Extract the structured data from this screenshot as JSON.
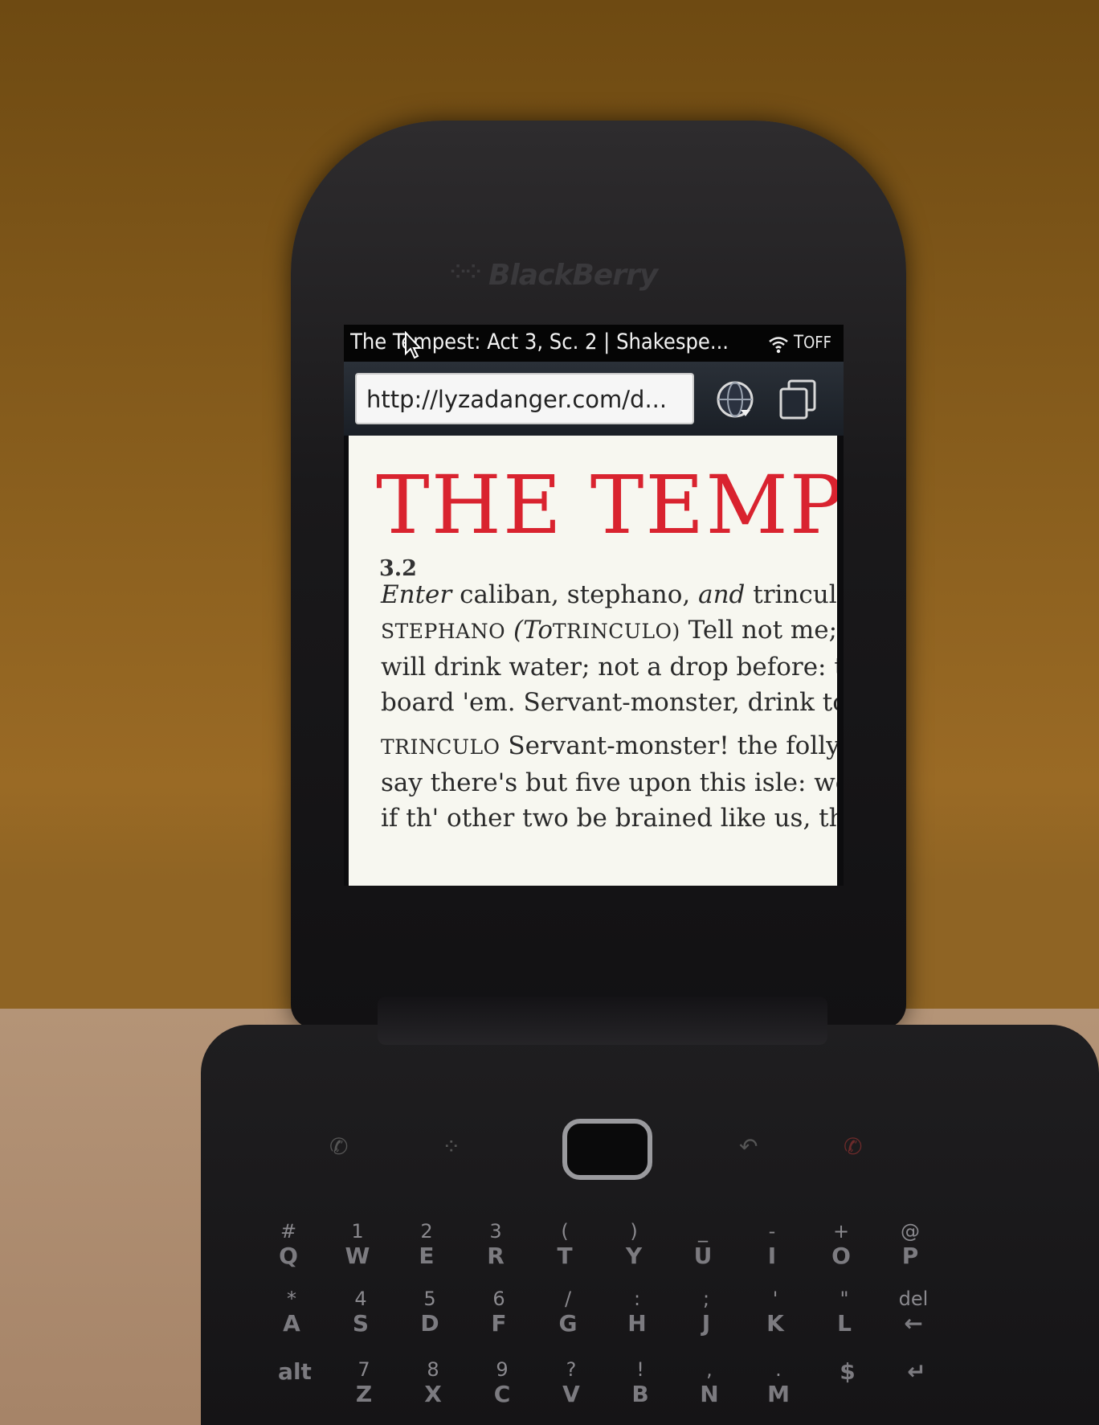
{
  "device": {
    "brand": "BlackBerry"
  },
  "statusbar": {
    "tab_title": "The Tempest: Act 3, Sc. 2 | Shakespe...",
    "radio_status": "OFF",
    "wifi_icon": "wifi-icon",
    "cursor_icon": "pointer-cursor-icon"
  },
  "toolbar": {
    "url": "http://lyzadanger.com/d...",
    "globe_icon": "globe-icon",
    "tabs_icon": "tabs-icon"
  },
  "page": {
    "title": "THE TEMPE",
    "scene": "3.2",
    "stage_direction": {
      "enter": "Enter",
      "chars1": "caliban, stephano,",
      "and": "and",
      "chars2": "trinculo"
    },
    "stephano_line": {
      "speaker": "STEPHANO",
      "aside_to": "(To",
      "aside_name": "TRINCULO)",
      "text1": "Tell not me; w",
      "text2": "will drink water; not a drop before: the",
      "text3": "board 'em. Servant-monster, drink to n"
    },
    "trinculo_line": {
      "speaker": "TRINCULO",
      "text1": "Servant-monster! the folly c",
      "text2": "say there's but five upon this isle: we a",
      "text3": "if th' other two be brained like us, the"
    }
  },
  "keyboard": {
    "row1": [
      {
        "alt": "#",
        "key": "Q"
      },
      {
        "alt": "1",
        "key": "W"
      },
      {
        "alt": "2",
        "key": "E"
      },
      {
        "alt": "3",
        "key": "R"
      },
      {
        "alt": "(",
        "key": "T"
      },
      {
        "alt": ")",
        "key": "Y"
      },
      {
        "alt": "_",
        "key": "U"
      },
      {
        "alt": "-",
        "key": "I"
      },
      {
        "alt": "+",
        "key": "O"
      },
      {
        "alt": "@",
        "key": "P"
      }
    ],
    "row2": [
      {
        "alt": "*",
        "key": "A"
      },
      {
        "alt": "4",
        "key": "S"
      },
      {
        "alt": "5",
        "key": "D"
      },
      {
        "alt": "6",
        "key": "F"
      },
      {
        "alt": "/",
        "key": "G"
      },
      {
        "alt": ":",
        "key": "H"
      },
      {
        "alt": ";",
        "key": "J"
      },
      {
        "alt": "'",
        "key": "K"
      },
      {
        "alt": "\"",
        "key": "L"
      },
      {
        "alt": "del",
        "key": "←"
      }
    ],
    "row3": [
      {
        "alt": "",
        "key": "alt"
      },
      {
        "alt": "7",
        "key": "Z"
      },
      {
        "alt": "8",
        "key": "X"
      },
      {
        "alt": "9",
        "key": "C"
      },
      {
        "alt": "?",
        "key": "V"
      },
      {
        "alt": "!",
        "key": "B"
      },
      {
        "alt": ",",
        "key": "N"
      },
      {
        "alt": ".",
        "key": "M"
      },
      {
        "alt": "",
        "key": "$"
      },
      {
        "alt": "",
        "key": "↵"
      }
    ]
  },
  "colors": {
    "title_red": "#d9232f",
    "page_bg": "#f7f7f0",
    "statusbar_bg": "#050505"
  }
}
